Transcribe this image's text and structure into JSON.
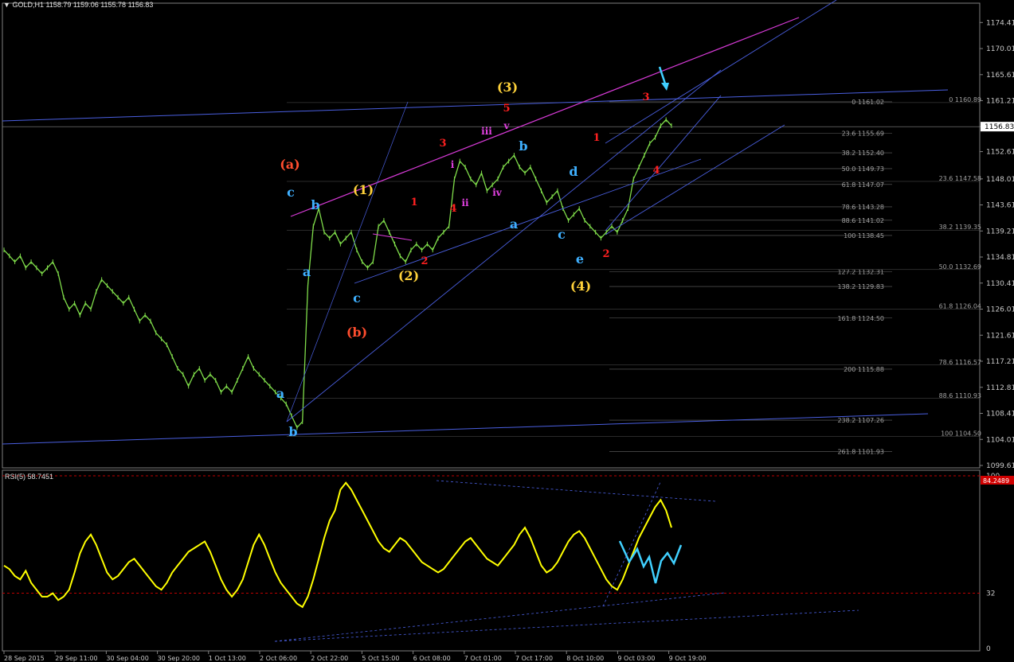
{
  "header": {
    "symbol": "GOLD,H1",
    "ohlc": "1158.79 1159.06 1155.78 1156.83"
  },
  "indicator": {
    "title": "RSI(5) 58.7451",
    "current_value": "84.2489",
    "levels": [
      "100",
      "32",
      "0"
    ]
  },
  "colors": {
    "background": "#000000",
    "candles": "#7fdc4a",
    "trendline": "#4a5fe0",
    "channel_top": "#d63ad6",
    "rsi": "#ffff00",
    "cyan": "#40d0ff",
    "level": "#c00000"
  },
  "chart_data": {
    "type": "line",
    "series": [
      {
        "values": [
          1136,
          1135,
          1134,
          1135,
          1133,
          1134,
          1133,
          1132,
          1133,
          1134,
          1132,
          1128,
          1126,
          1127,
          1125,
          1127,
          1126,
          1129,
          1131,
          1130,
          1129,
          1128,
          1127,
          1128,
          1126,
          1124,
          1125,
          1124,
          1122,
          1121,
          1120,
          1118,
          1116,
          1115,
          1113,
          1115,
          1116,
          1114,
          1115,
          1114,
          1112,
          1113,
          1112,
          1114,
          1116,
          1118,
          1116,
          1115,
          1114,
          1113,
          1112,
          1111,
          1110,
          1108,
          1106,
          1107,
          1130,
          1140,
          1143,
          1139,
          1138,
          1139,
          1137,
          1138,
          1139,
          1136,
          1134,
          1133,
          1134,
          1140,
          1141,
          1139,
          1137,
          1135,
          1134,
          1136,
          1137,
          1136,
          1137,
          1136,
          1138,
          1139,
          1140,
          1148,
          1151,
          1150,
          1148,
          1147,
          1149,
          1146,
          1147,
          1148,
          1150,
          1151,
          1152,
          1150,
          1149,
          1150,
          1148,
          1146,
          1144,
          1145,
          1146,
          1143,
          1141,
          1142,
          1143,
          1141,
          1140,
          1139,
          1138,
          1139,
          1140,
          1139,
          1141,
          1143,
          1148,
          1150,
          1152,
          1154,
          1155,
          1157,
          1158,
          1157
        ]
      }
    ],
    "ylim": [
      1099.61,
      1176.6
    ],
    "y_ticks": [
      "1174.41",
      "1170.01",
      "1165.61",
      "1161.21",
      "1156.83",
      "1152.61",
      "1148.01",
      "1143.61",
      "1139.21",
      "1134.81",
      "1130.41",
      "1126.01",
      "1121.61",
      "1117.21",
      "1112.81",
      "1108.41",
      "1104.01",
      "1099.61"
    ],
    "x_labels": [
      "28 Sep 2015",
      "29 Sep 11:00",
      "30 Sep 04:00",
      "30 Sep 20:00",
      "1 Oct 13:00",
      "2 Oct 06:00",
      "2 Oct 22:00",
      "5 Oct 15:00",
      "6 Oct 08:00",
      "7 Oct 01:00",
      "7 Oct 17:00",
      "8 Oct 10:00",
      "9 Oct 03:00",
      "9 Oct 19:00"
    ],
    "fib_left": [
      "0 1161.02",
      "23.6 1155.69",
      "38.2 1152.40",
      "50.0 1149.73",
      "61.8 1147.07",
      "78.6 1143.28",
      "88.6 1141.02",
      "100 1138.45",
      "127.2 1132.31",
      "138.2 1129.83",
      "161.8 1124.50",
      "200 1115.88",
      "238.2 1107.26",
      "261.8 1101.93"
    ],
    "fib_right": [
      "0 1160.89",
      "23.6 1147.58",
      "38.2 1139.35",
      "50.0 1132.69",
      "61.8 1126.04",
      "78.6 1116.57",
      "88.6 1110.93",
      "100 1104.50"
    ],
    "wave_labels": [
      "(a)",
      "(b)",
      "(1)",
      "(2)",
      "(3)",
      "(4)",
      "a",
      "b",
      "c",
      "a",
      "b",
      "c",
      "c",
      "d",
      "e",
      "1",
      "2",
      "3",
      "4",
      "5",
      "1",
      "2",
      "3",
      "4",
      "i",
      "ii",
      "iii",
      "iv",
      "v"
    ],
    "rsi_values": [
      48,
      46,
      42,
      40,
      45,
      38,
      34,
      30,
      30,
      32,
      28,
      30,
      34,
      44,
      55,
      62,
      66,
      60,
      52,
      44,
      40,
      42,
      46,
      50,
      52,
      48,
      44,
      40,
      36,
      34,
      38,
      44,
      48,
      52,
      56,
      58,
      60,
      62,
      56,
      48,
      40,
      34,
      30,
      34,
      40,
      50,
      60,
      66,
      60,
      52,
      44,
      38,
      34,
      30,
      26,
      24,
      30,
      40,
      52,
      64,
      74,
      80,
      92,
      96,
      92,
      86,
      80,
      74,
      68,
      62,
      58,
      56,
      60,
      64,
      62,
      58,
      54,
      50,
      48,
      46,
      44,
      46,
      50,
      54,
      58,
      62,
      64,
      60,
      56,
      52,
      50,
      48,
      52,
      56,
      60,
      66,
      70,
      64,
      56,
      48,
      44,
      46,
      50,
      56,
      62,
      66,
      68,
      64,
      58,
      52,
      46,
      40,
      36,
      34,
      40,
      48,
      56,
      64,
      70,
      76,
      82,
      86,
      80,
      70
    ]
  }
}
